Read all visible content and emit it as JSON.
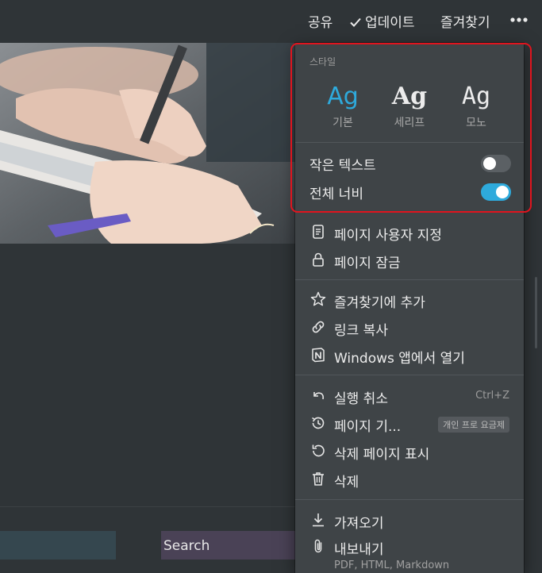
{
  "topbar": {
    "share_label": "공유",
    "update_label": "업데이트",
    "favorite_label": "즐겨찾기"
  },
  "menu": {
    "style_section_title": "스타일",
    "styles": [
      {
        "glyph": "Ag",
        "label": "기본",
        "active": true
      },
      {
        "glyph": "Ag",
        "label": "세리프",
        "active": false
      },
      {
        "glyph": "Ag",
        "label": "모노",
        "active": false
      }
    ],
    "toggles": {
      "small_text": {
        "label": "작은 텍스트",
        "on": false
      },
      "full_width": {
        "label": "전체 너비",
        "on": true
      }
    },
    "items": {
      "customize_page": "페이지 사용자 지정",
      "lock_page": "페이지 잠금",
      "add_favorite": "즐겨찾기에 추가",
      "copy_link": "링크 복사",
      "open_in_app": "Windows 앱에서 열기",
      "undo": "실행 취소",
      "undo_shortcut": "Ctrl+Z",
      "page_history": "페이지 기...",
      "page_history_badge": "개인 프로 요금제",
      "show_deleted": "삭제 페이지 표시",
      "delete": "삭제",
      "import": "가져오기",
      "export": "내보내기",
      "export_formats": "PDF, HTML, Markdown"
    }
  },
  "page": {
    "search_block": "Search"
  },
  "colors": {
    "accent": "#2eaadc",
    "menu_bg": "#3f4447",
    "page_bg": "#2f3437",
    "highlight": "#e0141e"
  }
}
